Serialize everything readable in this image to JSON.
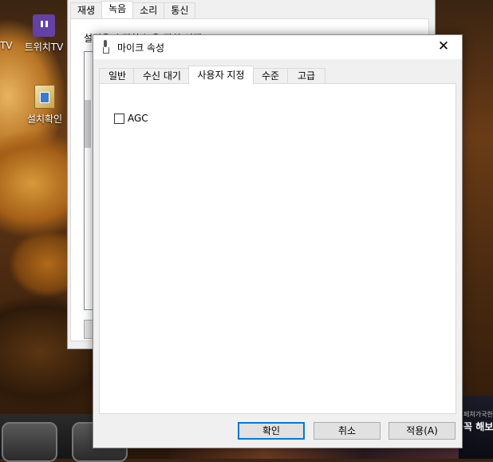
{
  "desktop": {
    "icons": [
      {
        "label": "TV"
      },
      {
        "label": "트위치TV"
      },
      {
        "label": "설치확인"
      }
    ],
    "ad_lines": [
      "페쳐가국한",
      "꼭 해보"
    ]
  },
  "background_dialog": {
    "tabs": [
      "재생",
      "녹음",
      "소리",
      "통신"
    ],
    "active_tab": "녹음",
    "hint": "설정을 수정할 녹음 장치 선택:"
  },
  "dialog": {
    "title": "마이크 속성",
    "close_glyph": "✕",
    "tabs": [
      "일반",
      "수신 대기",
      "사용자 지정",
      "수준",
      "고급"
    ],
    "active_tab": "사용자 지정",
    "agc": {
      "label": "AGC",
      "checked": false
    },
    "buttons": {
      "ok": "확인",
      "cancel": "취소",
      "apply": "적용(A)"
    },
    "accent_color": "#0078d7"
  }
}
